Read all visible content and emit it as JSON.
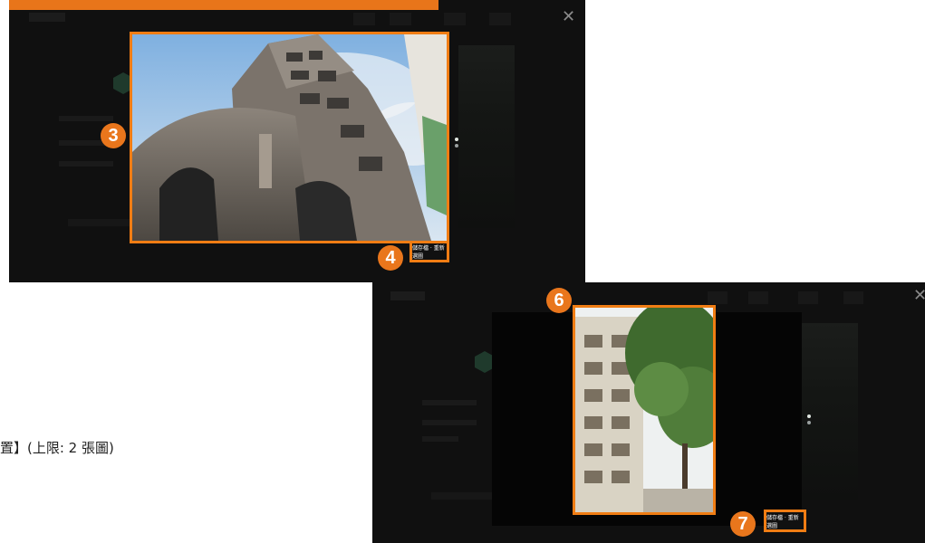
{
  "annotations": {
    "badge_3": "3",
    "badge_4": "4",
    "badge_6": "6",
    "badge_7": "7"
  },
  "captions": {
    "top": "儲存檔 · 重新選圖",
    "bottom": "儲存檔 · 重新選圖"
  },
  "limit_text": "置】(上限: 2 張圖)",
  "icons": {
    "close": "close-icon",
    "x_glyph": "✕"
  },
  "colors": {
    "accent": "#f07d14",
    "badge": "#e9761c",
    "panel": "#101010"
  }
}
